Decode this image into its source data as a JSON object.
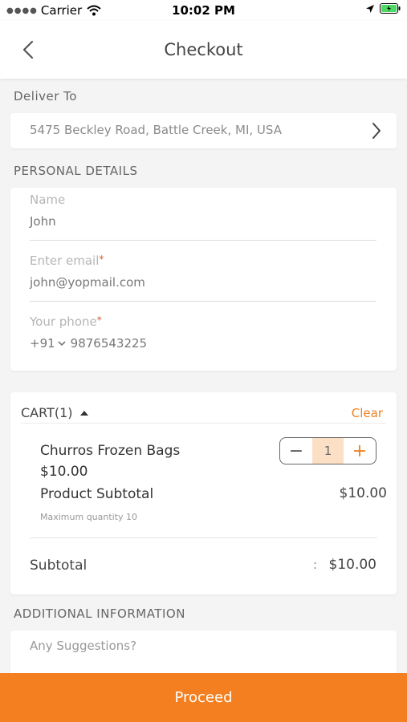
{
  "status_bar": {
    "carrier": "Carrier",
    "time": "10:02 PM"
  },
  "header": {
    "title": "Checkout",
    "back_icon": "chevron-left-icon"
  },
  "deliver": {
    "label": "Deliver To",
    "address": "5475 Beckley Road, Battle Creek, MI, USA"
  },
  "personal": {
    "label": "PERSONAL DETAILS",
    "name_label": "Name",
    "name_value": "John",
    "email_label": "Enter email",
    "email_value": "john@yopmail.com",
    "phone_label": "Your phone",
    "country_code": "+91",
    "phone_value": "9876543225",
    "required_mark": "*"
  },
  "cart": {
    "header": "CART(1)",
    "clear_label": "Clear",
    "item_name": "Churros Frozen Bags",
    "item_price": "$10.00",
    "quantity": "1",
    "minus_symbol": "−",
    "plus_symbol": "+",
    "product_subtotal_label": "Product Subtotal",
    "product_subtotal_value": "$10.00",
    "max_quantity_note": "Maximum quantity 10",
    "subtotal_label": "Subtotal",
    "subtotal_colon": ":",
    "subtotal_value": "$10.00"
  },
  "additional": {
    "label": "ADDITIONAL INFORMATION",
    "placeholder": "Any Suggestions?"
  },
  "footer": {
    "proceed_label": "Proceed"
  },
  "colors": {
    "accent": "#f47f20",
    "required": "#e2572b",
    "qty_bg": "#fce0c6"
  }
}
